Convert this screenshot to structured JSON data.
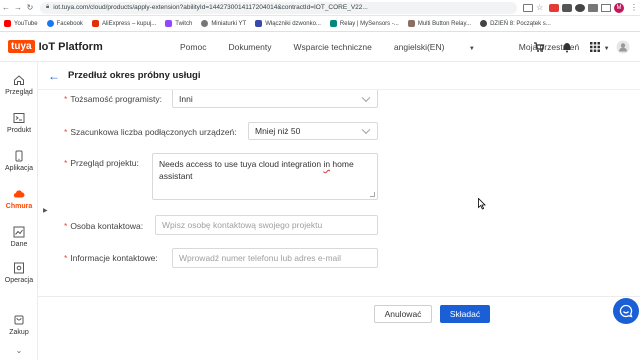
{
  "browser": {
    "url": "iot.tuya.com/cloud/products/apply-extension?abilityId=1442730014117204014&contractId=IOT_CORE_V22...",
    "bookmarks": [
      "YouTube",
      "Facebook",
      "AliExpress – kupuj...",
      "Twitch",
      "Miniaturki YT",
      "Włączniki dzwonko...",
      "Relay | MySensors -...",
      "Multi Button Relay...",
      "DZIEŃ 8: Początek s..."
    ],
    "profile_initial": "M"
  },
  "app": {
    "logo_badge": "tuya",
    "logo_text": "IoT Platform",
    "nav": [
      "Pomoc",
      "Dokumenty",
      "Wsparcie techniczne",
      "angielski(EN)",
      "Moja przestrzeń"
    ]
  },
  "sidebar": {
    "items": [
      {
        "label": "Przegląd",
        "icon": "home-icon"
      },
      {
        "label": "Produkt",
        "icon": "terminal-icon"
      },
      {
        "label": "Aplikacja",
        "icon": "phone-icon"
      },
      {
        "label": "Chmura",
        "icon": "cloud-icon",
        "active": true
      },
      {
        "label": "Dane",
        "icon": "chart-icon"
      },
      {
        "label": "Operacja",
        "icon": "settings-icon"
      },
      {
        "label": "Zakup",
        "icon": "cart-icon"
      }
    ]
  },
  "page": {
    "title": "Przedłuż okres próbny usługi"
  },
  "form": {
    "developer_identity": {
      "label": "Tożsamość programisty:",
      "value": "Inni"
    },
    "device_count": {
      "label": "Szacunkowa liczba podłączonych urządzeń:",
      "value": "Mniej niż 50"
    },
    "project_review": {
      "label": "Przegląd projektu:",
      "line1_a": "Needs access to use tuya cloud integration ",
      "line1_misspelled": "in",
      "line1_b": " home",
      "line2": "assistant"
    },
    "contact_person": {
      "label": "Osoba kontaktowa:",
      "placeholder": "Wpisz osobę kontaktową swojego projektu"
    },
    "contact_info": {
      "label": "Informacje kontaktowe:",
      "placeholder": "Wprowadź numer telefonu lub adres e-mail"
    }
  },
  "footer": {
    "cancel_label": "Anulować",
    "submit_label": "Składać"
  },
  "colors": {
    "brand": "#ff4800",
    "primary": "#1b5fd6",
    "required": "#e8483b"
  }
}
